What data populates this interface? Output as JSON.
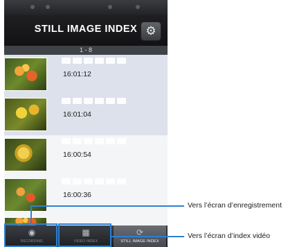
{
  "screen": {
    "title": "STILL IMAGE INDEX",
    "settings_icon": "gear-icon",
    "range": "1 - 8",
    "items": [
      {
        "time": "16:01:12"
      },
      {
        "time": "16:01:04"
      },
      {
        "time": "16:00:54"
      },
      {
        "time": "16:00:36"
      }
    ],
    "tabs": [
      {
        "label": "RECORDING",
        "icon": "record-icon"
      },
      {
        "label": "VIDEO INDEX",
        "icon": "video-index-icon"
      },
      {
        "label": "STILL IMAGE INDEX",
        "icon": "refresh-icon"
      }
    ]
  },
  "callouts": {
    "recording": "Vers l’écran d’enregistrement",
    "video_index": "Vers l’écran d’index vidéo"
  },
  "colors": {
    "highlight": "#2e7fd0",
    "titlebar": "#1a1a1c"
  }
}
